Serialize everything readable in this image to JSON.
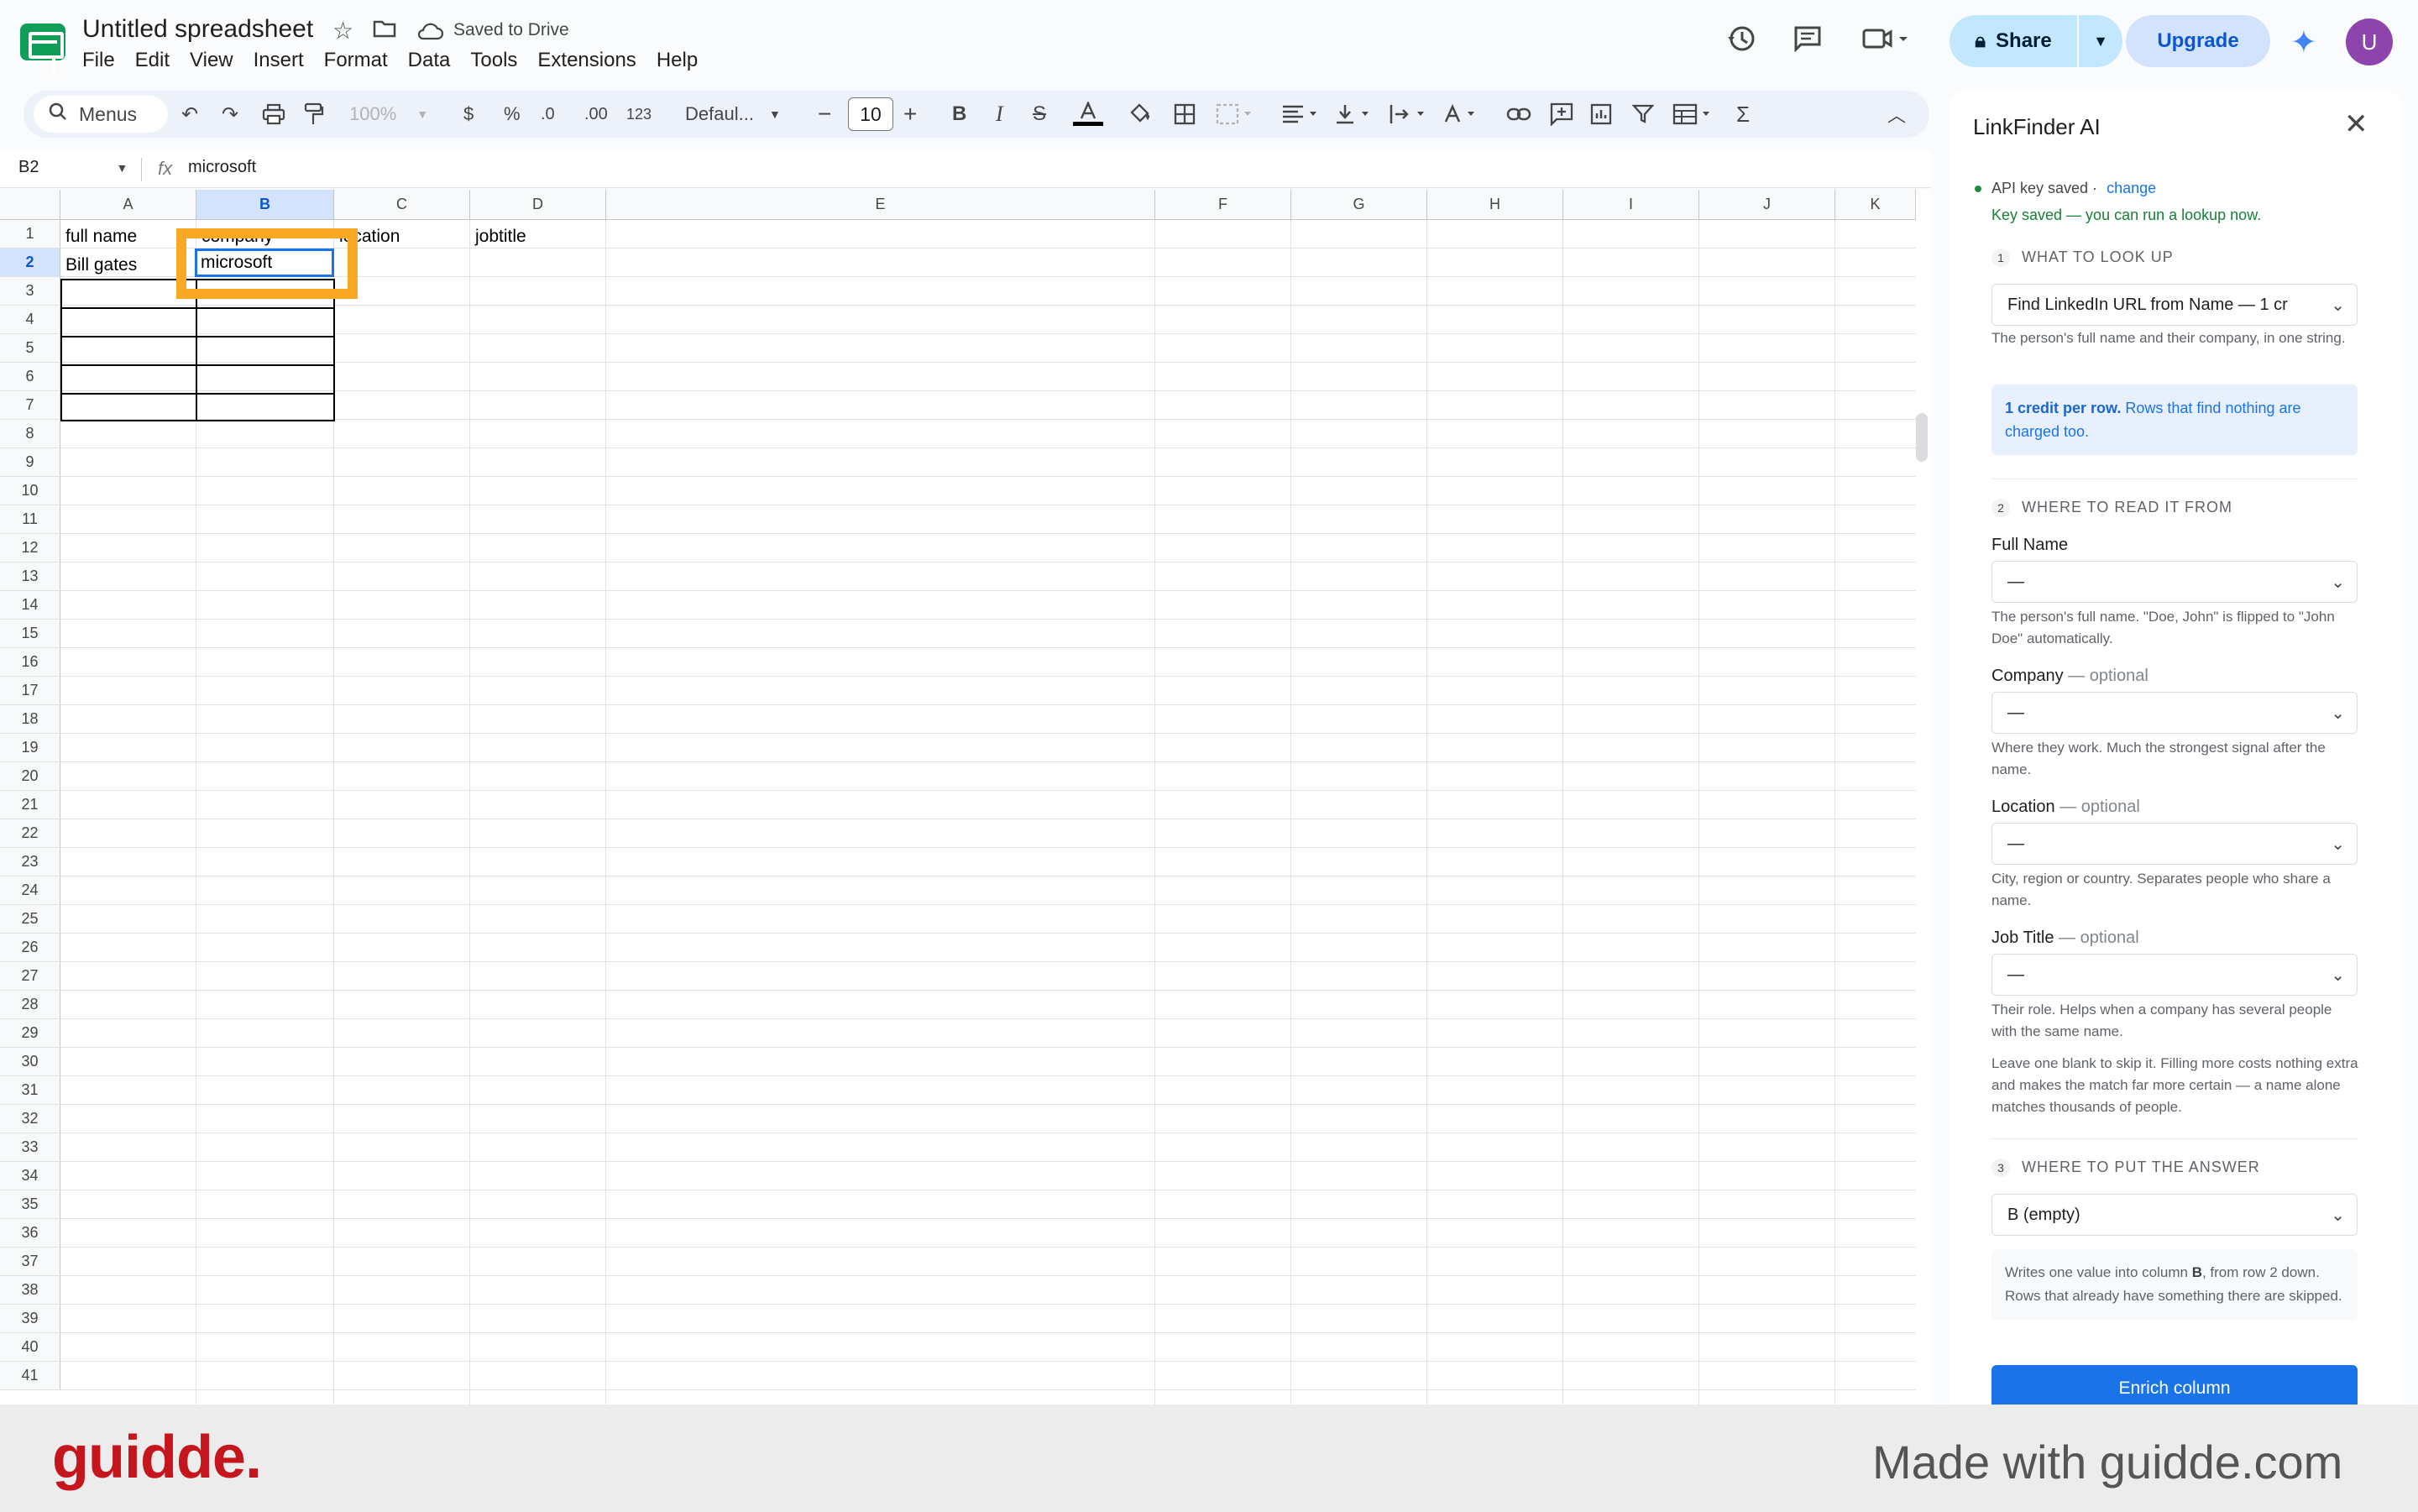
{
  "app": {
    "title": "Untitled spreadsheet",
    "saved_status": "Saved to Drive",
    "menu": [
      "File",
      "Edit",
      "View",
      "Insert",
      "Format",
      "Data",
      "Tools",
      "Extensions",
      "Help"
    ],
    "share_label": "Share",
    "upgrade_label": "Upgrade",
    "avatar_letter": "U"
  },
  "toolbar": {
    "menus_label": "Menus",
    "zoom": "100%",
    "currency": "$",
    "percent": "%",
    "dec_decrease": ".0",
    "dec_increase": ".00",
    "number_format": "123",
    "font": "Defaul...",
    "font_size": "10",
    "bold": "B",
    "italic": "I"
  },
  "formula_bar": {
    "cell_ref": "B2",
    "value": "microsoft"
  },
  "sheet": {
    "columns": [
      "A",
      "B",
      "C",
      "D",
      "E",
      "F",
      "G",
      "H",
      "I",
      "J",
      "K"
    ],
    "selected_column": "B",
    "rows": [
      "1",
      "2",
      "3",
      "4",
      "5",
      "6",
      "7",
      "8",
      "9",
      "10",
      "11",
      "12",
      "13",
      "14",
      "15",
      "16",
      "17",
      "18",
      "19",
      "20",
      "21",
      "22",
      "23",
      "24",
      "25",
      "26",
      "27",
      "28",
      "29",
      "30",
      "31",
      "32",
      "33",
      "34",
      "35",
      "36",
      "37",
      "38",
      "39",
      "40",
      "41"
    ],
    "cells": {
      "A1": "full name",
      "B1": "company",
      "C1": "location",
      "D1": "jobtitle",
      "A2": "Bill gates",
      "B2": "microsoft"
    }
  },
  "panel": {
    "title": "LinkFinder AI",
    "api_key_status": "API key saved ·",
    "api_change": "change",
    "key_saved_msg": "Key saved — you can run a lookup now.",
    "section1": {
      "num": "1",
      "title": "WHAT TO LOOK UP"
    },
    "lookup_select": "Find LinkedIn URL from Name — 1 cr",
    "lookup_help": "The person's full name and their company, in one string.",
    "credit_bold": "1 credit per row.",
    "credit_text": "Rows that find nothing are charged too.",
    "section2": {
      "num": "2",
      "title": "WHERE TO READ IT FROM"
    },
    "fields": [
      {
        "label": "Full Name",
        "optional": "",
        "value": "—",
        "help": "The person's full name. \"Doe, John\" is flipped to \"John Doe\" automatically."
      },
      {
        "label": "Company",
        "optional": "— optional",
        "value": "—",
        "help": "Where they work. Much the strongest signal after the name."
      },
      {
        "label": "Location",
        "optional": "— optional",
        "value": "—",
        "help": "City, region or country. Separates people who share a name."
      },
      {
        "label": "Job Title",
        "optional": "— optional",
        "value": "—",
        "help": "Their role. Helps when a company has several people with the same name."
      }
    ],
    "blank_note": "Leave one blank to skip it. Filling more costs nothing extra and makes the match far more certain — a name alone matches thousands of people.",
    "section3": {
      "num": "3",
      "title": "WHERE TO PUT THE ANSWER"
    },
    "output_select": "B (empty)",
    "output_help_1": "Writes one value into column ",
    "output_help_col": "B",
    "output_help_2": ", from row 2 down. Rows that already have something there are skipped.",
    "enrich_label": "Enrich column"
  },
  "footer": {
    "brand": "guidde.",
    "made_with": "Made with guidde.com"
  },
  "colors": {
    "accent": "#1a73e8",
    "highlight": "#f9a825",
    "brand": "#c4161c"
  }
}
